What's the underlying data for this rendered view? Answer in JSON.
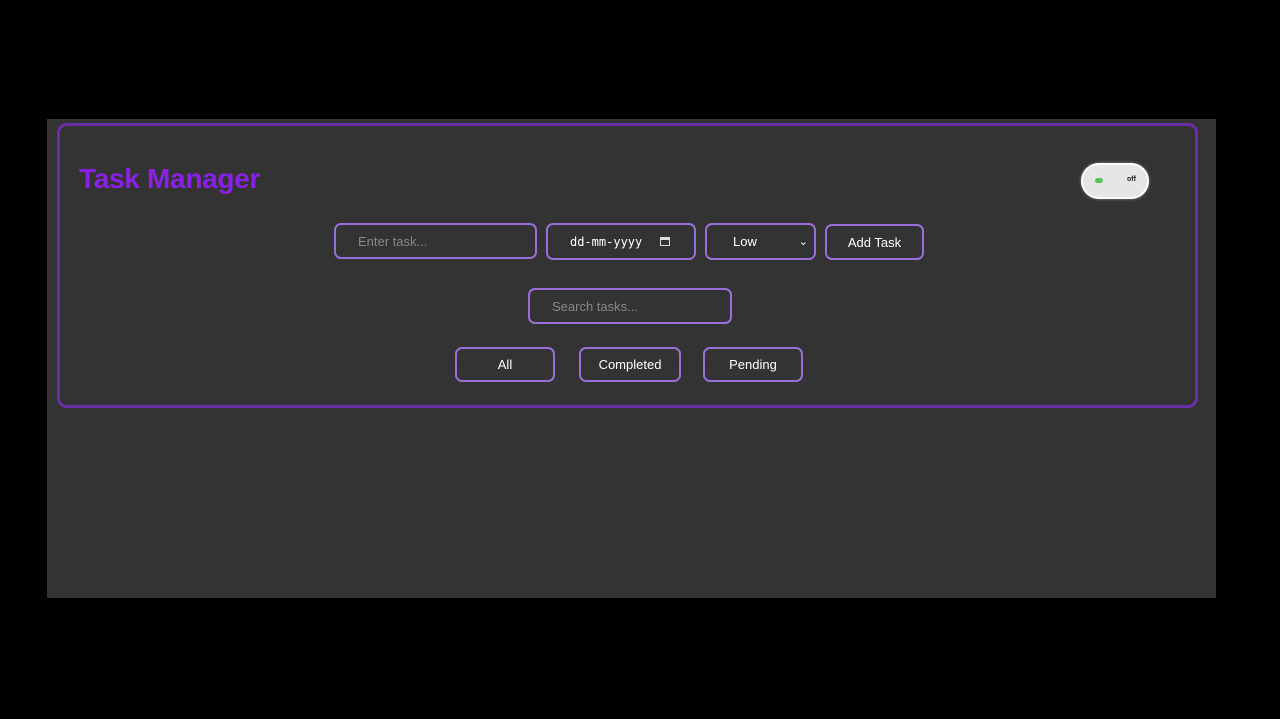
{
  "app": {
    "title": "Task Manager"
  },
  "theme_toggle": {
    "state": "dark",
    "off_label": "off"
  },
  "form": {
    "task_placeholder": "Enter task...",
    "date_placeholder": "dd-mm-yyyy",
    "priority_selected": "Low",
    "add_label": "Add Task"
  },
  "search": {
    "placeholder": "Search tasks..."
  },
  "filters": [
    {
      "label": "All"
    },
    {
      "label": "Completed"
    },
    {
      "label": "Pending"
    }
  ],
  "colors": {
    "accent": "#8a1fe6",
    "border": "#9b6fd9",
    "panel_border": "#6a2ea8",
    "background": "#333333"
  }
}
